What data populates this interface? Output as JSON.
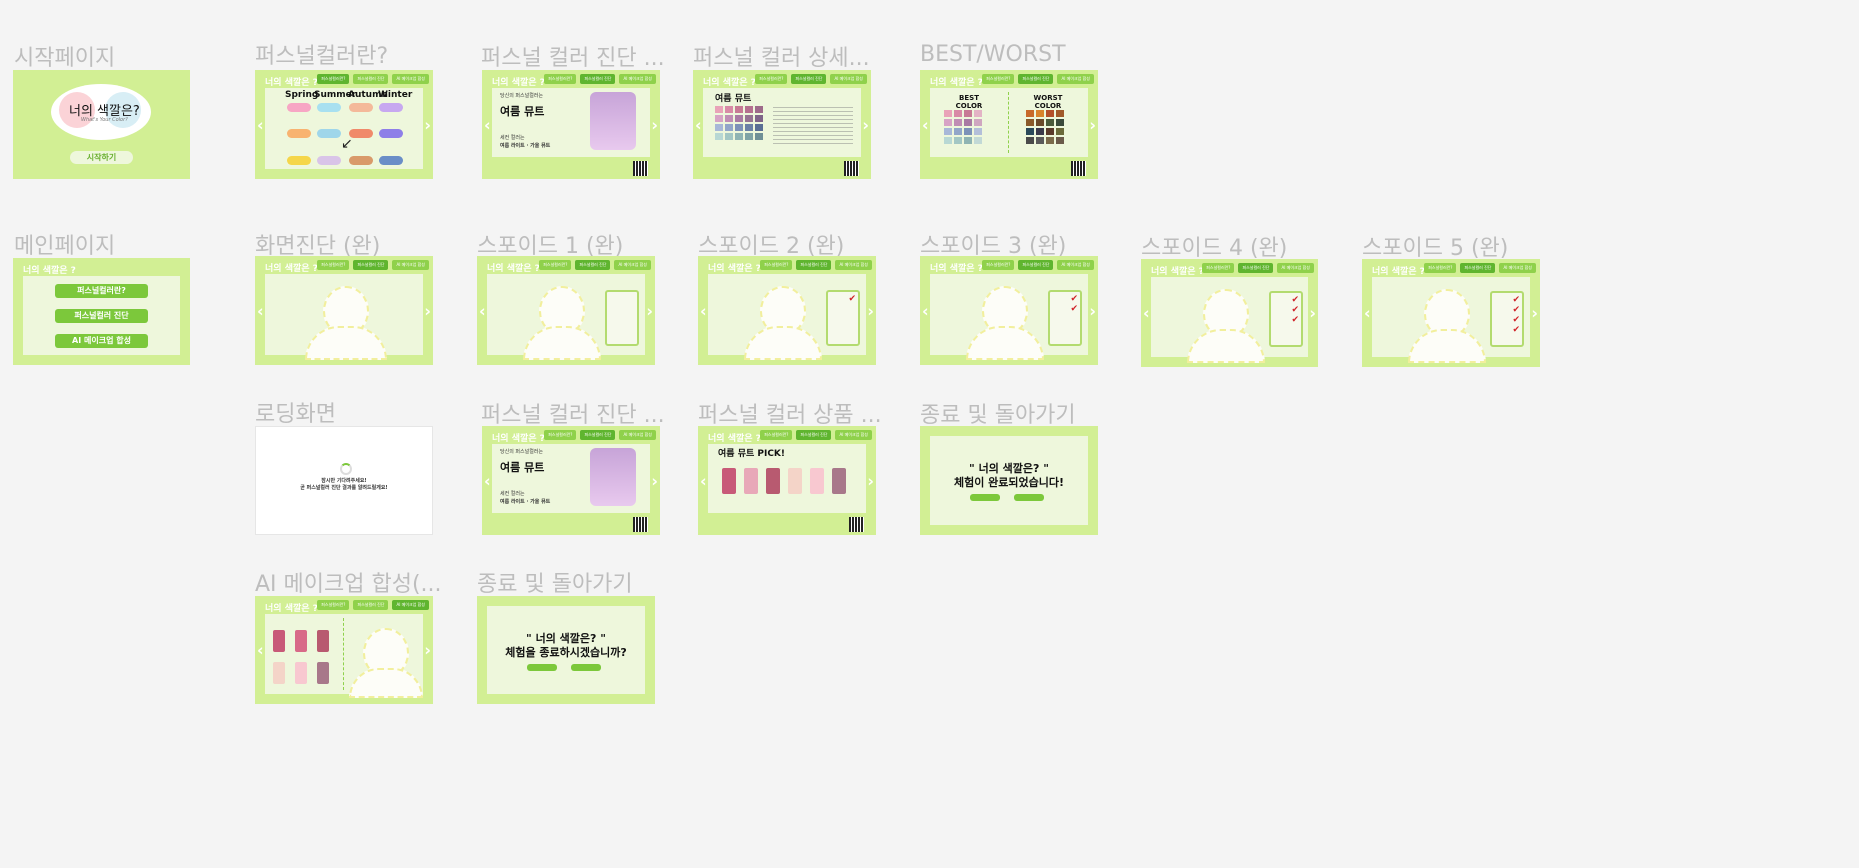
{
  "labels": {
    "start": "시작페이지",
    "personal_color_what": "퍼스널컬러란?",
    "diag1": "퍼스널 컬러 진단 ...",
    "detail": "퍼스널 컬러 상세...",
    "best_worst": "BEST/WORST",
    "main": "메인페이지",
    "screen_diag": "화면진단 (완)",
    "spoid1": "스포이드 1 (완)",
    "spoid2": "스포이드 2 (완)",
    "spoid3": "스포이드 3 (완)",
    "spoid4": "스포이드 4 (완)",
    "spoid5": "스포이드 5 (완)",
    "loading": "로딩화면",
    "diag2": "퍼스널 컬러 진단 ...",
    "product": "퍼스널 컬러 상품 ...",
    "end1": "종료 및 돌아가기",
    "ai_makeup": "AI 메이크업 합성(...",
    "end2": "종료 및 돌아가기"
  },
  "common": {
    "app_title": "너의 색깔은 ?",
    "tab1": "퍼스널컬러란?",
    "tab2": "퍼스널컬러 진단",
    "tab3": "AI 메이크업 합성"
  },
  "start_page": {
    "logo_title": "너의 색깔은?",
    "logo_sub": "What's Your Color?",
    "start_button": "시작하기"
  },
  "season_page": {
    "seasons": [
      "Spring",
      "Summer",
      "Autumn",
      "Winter"
    ]
  },
  "diag_page": {
    "intro": "당신의 퍼스널컬러는",
    "result": "여름 뮤트",
    "second_label": "세컨 컬러는",
    "second": "여름 라이트 · 가을 뮤트"
  },
  "detail_page": {
    "title": "여름 뮤트"
  },
  "bw_page": {
    "best": "BEST COLOR",
    "worst": "WORST COLOR"
  },
  "main_page": {
    "buttons": [
      "퍼스널컬러란?",
      "퍼스널컬러 진단",
      "AI 메이크업 합성"
    ]
  },
  "loading_page": {
    "line1": "잠시만 기다려주세요!",
    "line2": "곧 퍼스널컬러 진단 결과를 알려드릴게요!"
  },
  "product_page": {
    "title": "여름 뮤트 PICK!"
  },
  "end_page1": {
    "quote": "\" 너의 색깔은? \"",
    "message": "체험이 완료되었습니다!"
  },
  "end_page2": {
    "quote": "\" 너의 색깔은? \"",
    "message": "체험을 종료하시겠습니까?"
  }
}
